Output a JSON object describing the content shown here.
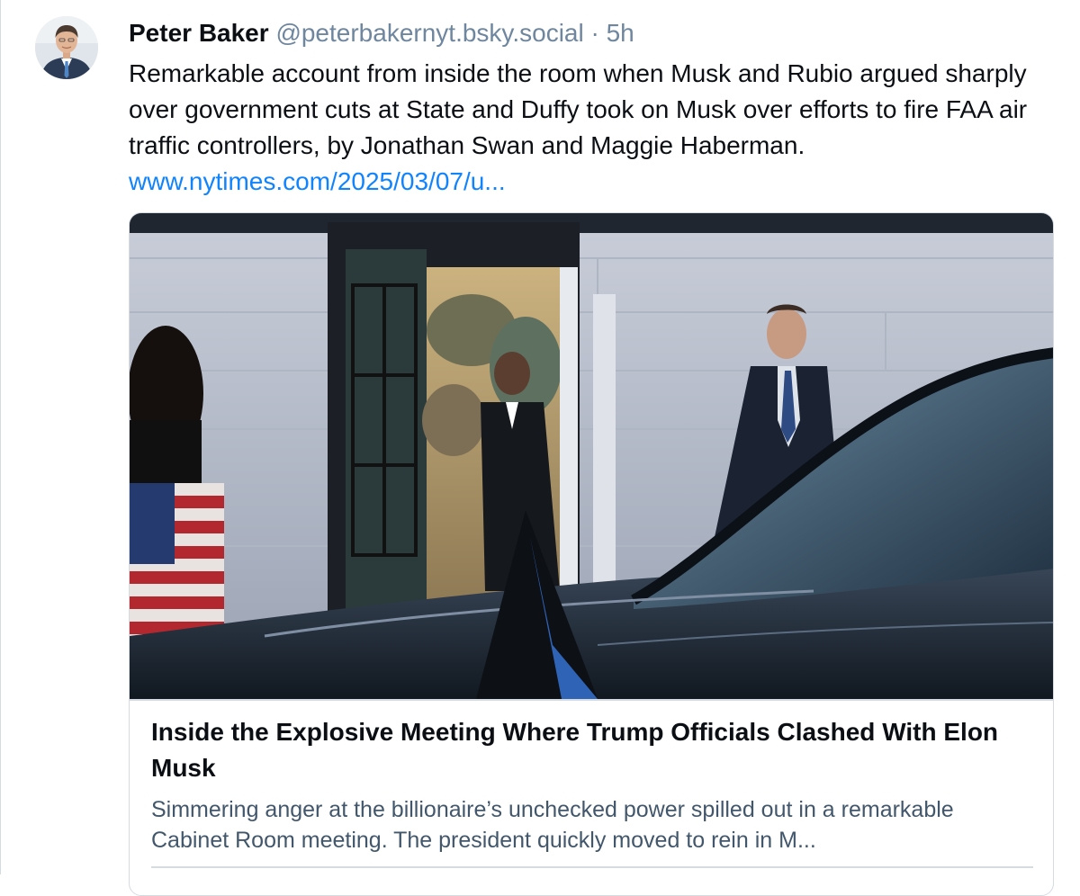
{
  "post": {
    "author": {
      "display_name": "Peter Baker",
      "handle": "@peterbakernyt.bsky.social",
      "separator": "·",
      "timestamp": "5h",
      "avatar_icon": "person-avatar-icon"
    },
    "text_before_link": "Remarkable account from inside the room when Musk and Rubio argued sharply over government cuts at State and Duffy took on Musk over efforts to fire FAA air traffic controllers, by Jonathan Swan and Maggie Haberman. ",
    "link_text": "www.nytimes.com/2025/03/07/u..."
  },
  "embed_card": {
    "image_icon": "article-photo",
    "title": "Inside the Explosive Meeting Where Trump Officials Clashed With Elon Musk",
    "description": "Simmering anger at the billionaire’s unchecked power spilled out in a remarkable Cabinet Room meeting. The president quickly moved to rein in M..."
  },
  "colors": {
    "text_primary": "#0b0f14",
    "text_secondary": "#6f869f",
    "link": "#1083fe",
    "border": "#d4dbe2"
  }
}
